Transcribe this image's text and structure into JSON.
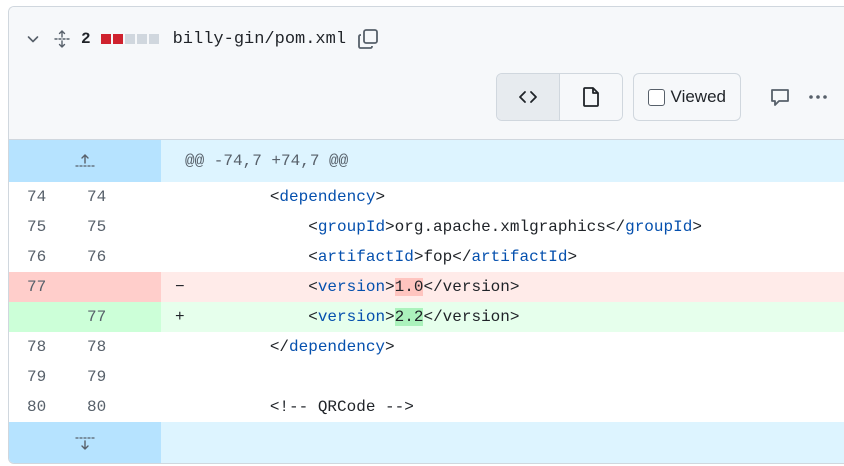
{
  "file": {
    "changes_count": "2",
    "diffstat": [
      "#cf222e",
      "#cf222e",
      "#d0d7de",
      "#d0d7de",
      "#d0d7de"
    ],
    "name": "billy-gin/pom.xml"
  },
  "toolbar": {
    "viewed_label": "Viewed"
  },
  "hunk_header": "@@ -74,7 +74,7 @@",
  "lines": [
    {
      "type": "ctx",
      "old": "74",
      "new": "74",
      "sign": "",
      "indent": "        ",
      "pre": "<",
      "tag1": "dependency",
      "mid": ">",
      "hl": "",
      "tag2": "",
      "post": ""
    },
    {
      "type": "ctx",
      "old": "75",
      "new": "75",
      "sign": "",
      "indent": "            ",
      "pre": "<",
      "tag1": "groupId",
      "mid": ">org.apache.xmlgraphics</",
      "hl": "",
      "tag2": "groupId",
      "post": ">"
    },
    {
      "type": "ctx",
      "old": "76",
      "new": "76",
      "sign": "",
      "indent": "            ",
      "pre": "<",
      "tag1": "artifactId",
      "mid": ">fop</",
      "hl": "",
      "tag2": "artifactId",
      "post": ">"
    },
    {
      "type": "del",
      "old": "77",
      "new": "",
      "sign": "−",
      "indent": "            ",
      "pre": "<",
      "tag1": "version",
      "mid": ">",
      "hl": "1.0",
      "tag2": "",
      "post": "</version>"
    },
    {
      "type": "add",
      "old": "",
      "new": "77",
      "sign": "+",
      "indent": "            ",
      "pre": "<",
      "tag1": "version",
      "mid": ">",
      "hl": "2.2",
      "tag2": "",
      "post": "</version>"
    },
    {
      "type": "ctx",
      "old": "78",
      "new": "78",
      "sign": "",
      "indent": "        ",
      "pre": "</",
      "tag1": "dependency",
      "mid": ">",
      "hl": "",
      "tag2": "",
      "post": ""
    },
    {
      "type": "ctx",
      "old": "79",
      "new": "79",
      "sign": "",
      "indent": "",
      "pre": "",
      "tag1": "",
      "mid": "",
      "hl": "",
      "tag2": "",
      "post": ""
    },
    {
      "type": "ctx",
      "old": "80",
      "new": "80",
      "sign": "",
      "indent": "        ",
      "pre": "<!-- QRCode -->",
      "tag1": "",
      "mid": "",
      "hl": "",
      "tag2": "",
      "post": ""
    }
  ]
}
